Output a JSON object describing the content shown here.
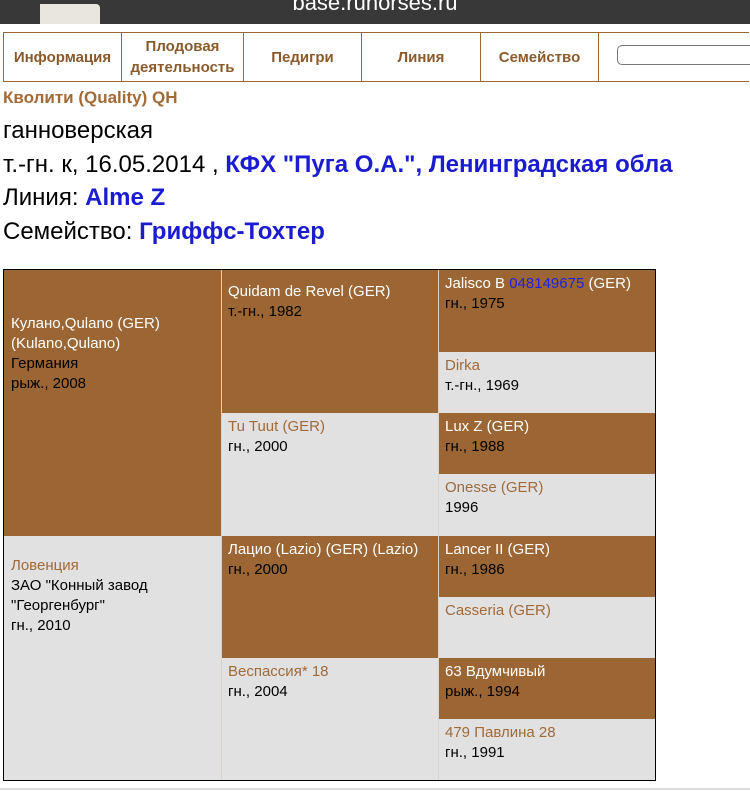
{
  "browser": {
    "url": "base.runorses.ru"
  },
  "nav": {
    "tabs": [
      "Информация",
      "Плодовая деятельность",
      "Педигри",
      "Линия",
      "Семейство"
    ],
    "search_placeholder": ""
  },
  "horse": {
    "title": "Кволити (Quality) QH",
    "breed": "ганноверская",
    "details_prefix": "т.-гн. к, 16.05.2014 ,",
    "owner": "КФХ \"Пуга О.А.\", Ленинградская обла",
    "line_label": "Линия:",
    "line_value": "Alme Z",
    "family_label": "Семейство:",
    "family_value": "Гриффс-Тохтер"
  },
  "pedigree": {
    "sire": {
      "name": "Кулано,Qulano (GER) (Kulano,Qulano)",
      "country": "Германия",
      "info": "рыж., 2008"
    },
    "dam": {
      "name": "Ловенция",
      "breeder": "ЗАО \"Конный завод \"Георгенбург\"",
      "info": "гн., 2010"
    },
    "ss": {
      "name": "Quidam de Revel (GER)",
      "info": "т.-гн., 1982"
    },
    "sd": {
      "name": "Tu Tuut (GER)",
      "info": "гн., 2000"
    },
    "ds": {
      "name": "Лацио (Lazio) (GER) (Lazio)",
      "info": "гн., 2000"
    },
    "dd": {
      "name": "Веспассия* 18",
      "info": "гн., 2004"
    },
    "sss": {
      "name": "Jalisco B",
      "reg": "048149675",
      "suffix": "(GER)",
      "info": "гн., 1975"
    },
    "ssd": {
      "name": "Dirka",
      "info": "т.-гн., 1969"
    },
    "sds": {
      "name": "Lux Z (GER)",
      "info": "гн., 1988"
    },
    "sdd": {
      "name": "Onesse (GER)",
      "info": "1996"
    },
    "dss": {
      "name": "Lancer II (GER)",
      "info": "гн., 1986"
    },
    "dsd": {
      "name": "Casseria (GER)",
      "info": ""
    },
    "dds": {
      "name": "63 Вдумчивый",
      "info": "рыж., 1994"
    },
    "ddd": {
      "name": "479 Павлина 28",
      "info": "гн., 1991"
    }
  },
  "colors": {
    "brown": "#9b6633",
    "gray": "#e2e1e1",
    "link_blue": "#1b1ccf",
    "title_brown": "#a26a36"
  }
}
